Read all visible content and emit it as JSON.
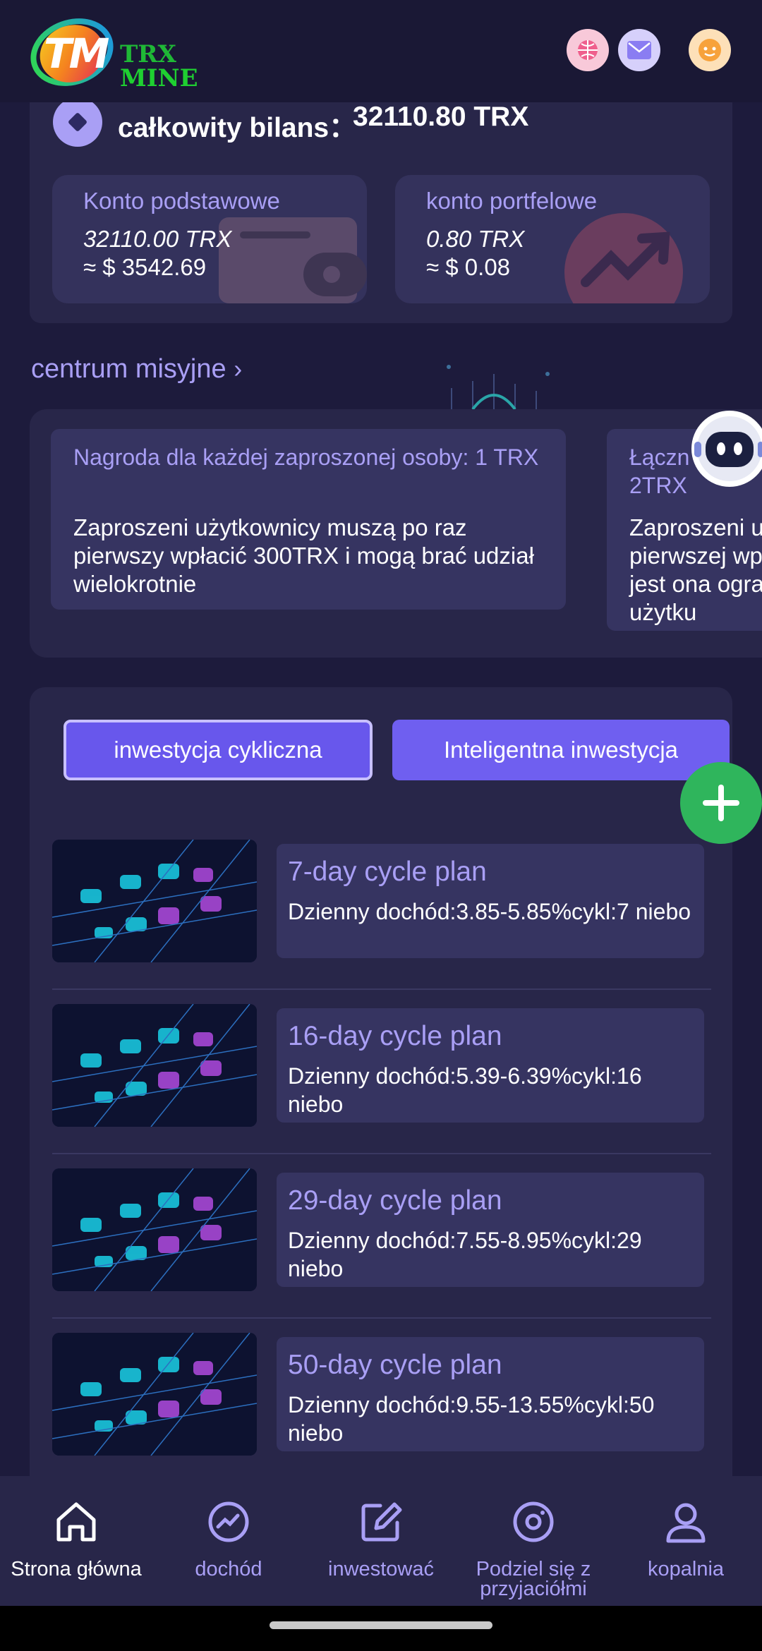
{
  "header": {
    "logo_mark": "TM",
    "logo_text_line1": "TRX",
    "logo_text_line2": "MINE",
    "icons": [
      "globe-icon",
      "mail-icon",
      "support-icon"
    ]
  },
  "balance": {
    "label": "całkowity bilans：",
    "value": "32110.80 TRX",
    "accounts": [
      {
        "title": "Konto podstawowe",
        "trx": "32110.00 TRX",
        "usd": "≈ $ 3542.69",
        "icon": "wallet-icon"
      },
      {
        "title": "konto portfelowe",
        "trx": "0.80 TRX",
        "usd": "≈ $ 0.08",
        "icon": "trend-icon"
      }
    ]
  },
  "mission": {
    "title": "centrum misyjne",
    "cards": [
      {
        "title": "Nagroda dla każdej zaproszonej osoby: 1 TRX",
        "desc": "Zaproszeni użytkownicy muszą po raz pierwszy wpłacić 300TRX i mogą brać udział wielokrotnie"
      },
      {
        "title": "Łączn\n2TRX",
        "desc": "Zaproszeni u\npierwszej wp\njest ona ogra\nużytku"
      }
    ]
  },
  "invest": {
    "tabs": [
      {
        "label": "inwestycja cykliczna",
        "active": true
      },
      {
        "label": "Inteligentna inwestycja",
        "active": false
      }
    ],
    "plans": [
      {
        "name": "7-day cycle plan",
        "desc": "Dzienny dochód:3.85-5.85%cykl:7 niebo"
      },
      {
        "name": "16-day cycle plan",
        "desc": "Dzienny dochód:5.39-6.39%cykl:16 niebo"
      },
      {
        "name": "29-day cycle plan",
        "desc": "Dzienny dochód:7.55-8.95%cykl:29 niebo"
      },
      {
        "name": "50-day cycle plan",
        "desc": "Dzienny dochód:9.55-13.55%cykl:50 niebo"
      }
    ]
  },
  "nav": {
    "items": [
      {
        "label": "Strona główna",
        "icon": "home-icon",
        "active": true
      },
      {
        "label": "dochód",
        "icon": "income-chart-icon",
        "active": false
      },
      {
        "label": "inwestować",
        "icon": "edit-icon",
        "active": false
      },
      {
        "label": "Podziel się z przyjaciółmi",
        "icon": "share-icon",
        "active": false
      },
      {
        "label": "kopalnia",
        "icon": "user-icon",
        "active": false
      }
    ]
  },
  "colors": {
    "background": "#1d1b3c",
    "card": "#282649",
    "accent": "#6f5ff0",
    "accent_text": "#a99ff5",
    "fab": "#2fb55c"
  }
}
